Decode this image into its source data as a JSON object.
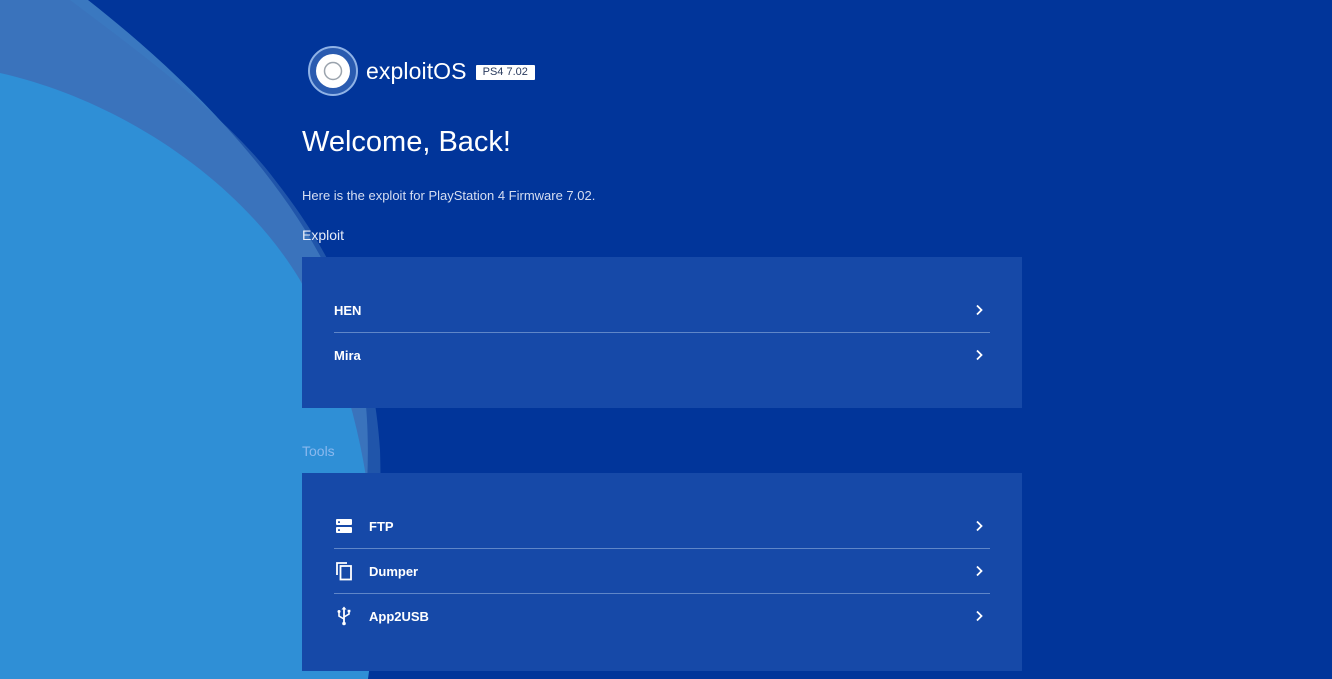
{
  "brand": {
    "name": "exploitOS",
    "version_badge": "PS4 7.02"
  },
  "welcome": {
    "title": "Welcome, Back!",
    "subtitle": "Here is the exploit for PlayStation 4 Firmware 7.02."
  },
  "sections": {
    "exploit": {
      "label": "Exploit",
      "items": [
        {
          "label": "HEN",
          "icon": "chevron-right-icon"
        },
        {
          "label": "Mira",
          "icon": "chevron-right-icon"
        }
      ]
    },
    "tools": {
      "label": "Tools",
      "items": [
        {
          "label": "FTP",
          "icon": "server-icon"
        },
        {
          "label": "Dumper",
          "icon": "copy-icon"
        },
        {
          "label": "App2USB",
          "icon": "usb-icon"
        }
      ]
    }
  },
  "colors": {
    "background": "#01359a",
    "panel": "#1649a8",
    "wave_light": "#2f8fd6",
    "wave_mid": "#3a78c0",
    "badge_bg": "#ffffff",
    "tools_label": "#8ab8ee"
  }
}
